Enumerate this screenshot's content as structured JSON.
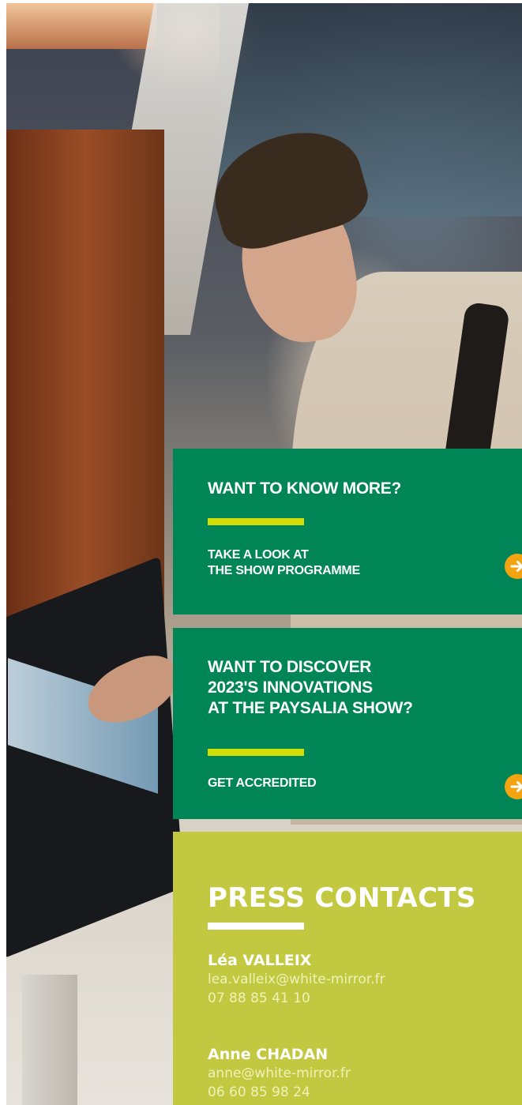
{
  "box_programme": {
    "heading": "WANT TO KNOW MORE?",
    "link_line1": "TAKE A LOOK AT",
    "link_line2": "THE SHOW PROGRAMME"
  },
  "box_accreditation": {
    "heading_line1": "WANT TO DISCOVER",
    "heading_line2": "2023'S INNOVATIONS",
    "heading_line3": "AT THE PAYSALIA SHOW?",
    "link": "GET ACCREDITED"
  },
  "press": {
    "title": "PRESS CONTACTS",
    "contacts": [
      {
        "name": "Léa VALLEIX",
        "email": "lea.valleix@white-mirror.fr",
        "phone": "07 88 85 41 10"
      },
      {
        "name": "Anne CHADAN",
        "email": "anne@white-mirror.fr",
        "phone": "06 60 85 98 24"
      }
    ]
  },
  "colors": {
    "green_panel": "#008556",
    "lime_panel": "#c2c83f",
    "accent_bar": "#d3dd06",
    "arrow_button": "#f4a311"
  },
  "icons": {
    "arrow": "arrow-right-icon"
  }
}
